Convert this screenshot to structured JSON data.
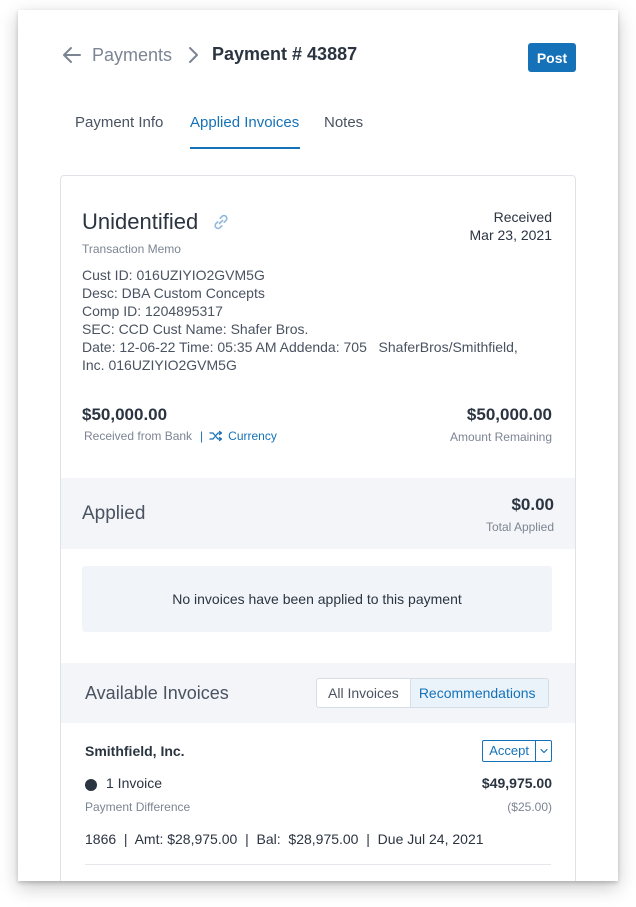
{
  "header": {
    "breadcrumb_parent": "Payments",
    "breadcrumb_current": "Payment # 43887",
    "post_label": "Post"
  },
  "tabs": [
    {
      "label": "Payment Info",
      "active": false
    },
    {
      "label": "Applied Invoices",
      "active": true
    },
    {
      "label": "Notes",
      "active": false
    }
  ],
  "transaction": {
    "title": "Unidentified",
    "memo_label": "Transaction Memo",
    "received_label": "Received",
    "received_date": "Mar 23, 2021",
    "memo_lines": [
      "Cust ID: 016UZIYIO2GVM5G",
      "Desc: DBA Custom Concepts",
      "Comp ID: 1204895317",
      "SEC: CCD Cust Name: Shafer Bros.",
      "Date: 12-06-22 Time: 05:35 AM Addenda: 705   ShaferBros/Smithfield,",
      "Inc. 016UZIYIO2GVM5G"
    ],
    "received_amount": "$50,000.00",
    "received_from_label": "Received from Bank",
    "separator": "|",
    "currency_link": "Currency",
    "remaining_amount": "$50,000.00",
    "remaining_label": "Amount Remaining"
  },
  "applied": {
    "title": "Applied",
    "amount": "$0.00",
    "amount_label": "Total Applied",
    "empty_message": "No invoices have been applied to this payment"
  },
  "available": {
    "title": "Available Invoices",
    "toggle": {
      "options": [
        "All Invoices",
        "Recommendations"
      ],
      "active": "Recommendations"
    },
    "customers": [
      {
        "name": "Smithfield, Inc.",
        "accept_label": "Accept",
        "invoice_count": "1 Invoice",
        "invoice_total": "$49,975.00",
        "difference_label": "Payment Difference",
        "difference_amount": "($25.00)",
        "invoice_line": "1866  |  Amt: $28,975.00  |  Bal:  $28,975.00  |  Due Jul 24, 2021"
      }
    ]
  },
  "colors": {
    "accent": "#1672b8",
    "text": "#2b3441",
    "muted": "#7c8593",
    "band": "#f3f5f8"
  }
}
